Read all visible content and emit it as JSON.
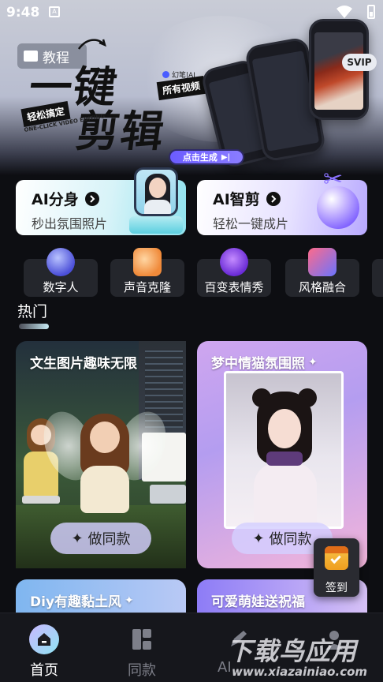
{
  "status_bar": {
    "time": "9:48"
  },
  "banner": {
    "tutorial_label": "教程",
    "title_line1": "一键",
    "title_line2": "剪辑",
    "tag_easy": "轻松搞定",
    "tag_english": "ONE-CLICK VIDEO EDITING",
    "brand": "幻笔|AI",
    "tag_all_videos": "所有视频",
    "generate_button": "点击生成",
    "svip_badge": "SVIP"
  },
  "feature_cards": [
    {
      "title": "AI分身",
      "subtitle": "秒出氛围照片"
    },
    {
      "title": "AI智剪",
      "subtitle": "轻松一键成片"
    }
  ],
  "tools": [
    {
      "label": "数字人",
      "icon": "digital-human-icon"
    },
    {
      "label": "声音克隆",
      "icon": "speaker-icon"
    },
    {
      "label": "百变表情秀",
      "icon": "devil-face-icon"
    },
    {
      "label": "风格融合",
      "icon": "style-fusion-icon"
    }
  ],
  "section": {
    "title": "热门"
  },
  "cards": [
    {
      "title": "文生图片趣味无限",
      "button": "做同款"
    },
    {
      "title": "梦中情猫氛围照",
      "button": "做同款"
    },
    {
      "title": "Diy有趣黏土风"
    },
    {
      "title": "可爱萌娃送祝福"
    }
  ],
  "sign_in": {
    "label": "签到"
  },
  "tab_bar": {
    "tabs": [
      {
        "label": "首页",
        "active": true
      },
      {
        "label": "同款",
        "active": false
      },
      {
        "label": "AI",
        "active": false
      },
      {
        "label": "",
        "active": false
      }
    ]
  },
  "watermark": {
    "line1": "下载鸟应用",
    "line2": "www.xiazainiao.com"
  },
  "colors": {
    "background": "#0d0e12",
    "accent": "#6b5cff",
    "tab_inactive": "#7d7f89"
  }
}
